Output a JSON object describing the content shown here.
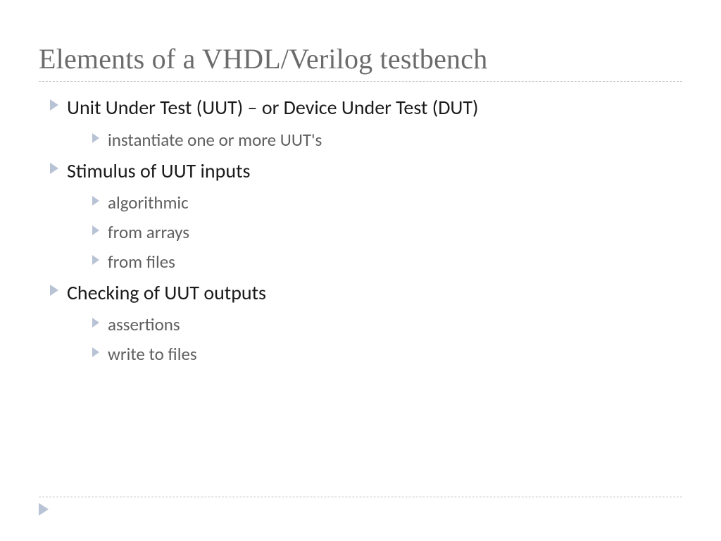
{
  "title": "Elements of a VHDL/Verilog testbench",
  "items": [
    {
      "text": "Unit Under Test (UUT) – or Device Under Test (DUT)",
      "sub": [
        "instantiate one or more UUT's"
      ]
    },
    {
      "text": "Stimulus of UUT inputs",
      "sub": [
        "algorithmic",
        "from arrays",
        "from files"
      ]
    },
    {
      "text": "Checking of UUT outputs",
      "sub": [
        "assertions",
        "write to files"
      ]
    }
  ]
}
